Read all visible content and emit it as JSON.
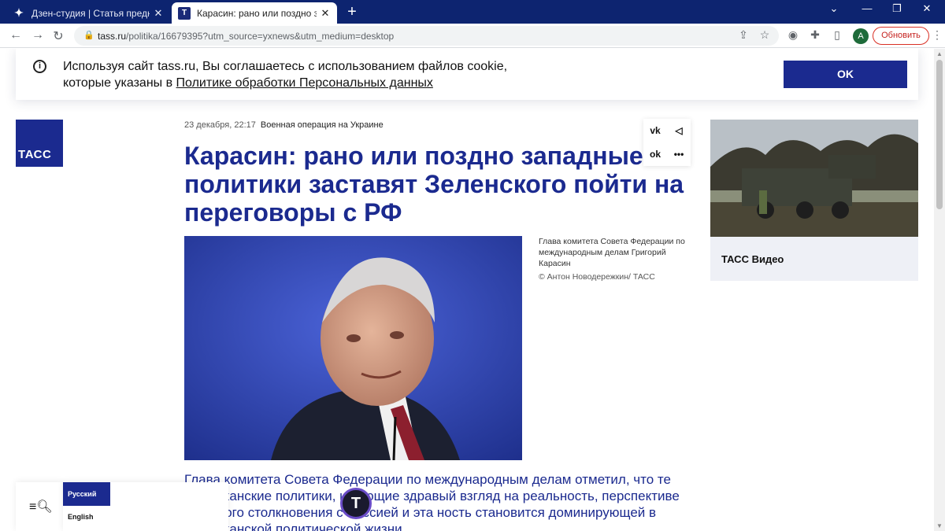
{
  "browser": {
    "tabs": [
      {
        "title": "Дзен-студия | Статья предновогодняя"
      },
      {
        "title": "Карасин: рано или поздно западные"
      }
    ],
    "url_host": "tass.ru",
    "url_path": "/politika/16679395?utm_source=yxnews&utm_medium=desktop",
    "avatar_letter": "A",
    "update_label": "Обновить"
  },
  "cookie": {
    "text": "Используя сайт tass.ru, Вы соглашаетесь с использованием файлов cookie, которые указаны в ",
    "link": "Политике обработки Персональных данных",
    "ok_label": "OK"
  },
  "logo_text": "ТАСС",
  "article": {
    "date": "23 декабря, 22:17",
    "rubric": "Военная операция на Украине",
    "headline": "Карасин: рано или поздно западные политики заставят Зеленского пойти на переговоры с РФ",
    "caption": "Глава комитета Совета Федерации по международным делам Григорий Карасин",
    "credit": "© Антон Новодережкин/ ТАСС",
    "lead": "Глава комитета Совета Федерации по международным делам отметил, что те американские политики, имеющие здравый взгляд на реальность, перспективе большого столкновения с Россией и эта ность становится доминирующей в американской политической жизни"
  },
  "share": {
    "vk": "vk",
    "telegram": "◁",
    "ok": "ok",
    "more": "•••"
  },
  "video_widget": {
    "label": "ТАСС Видео"
  },
  "languages": {
    "ru": "Русский",
    "en": "English"
  },
  "fab_letter": "T"
}
